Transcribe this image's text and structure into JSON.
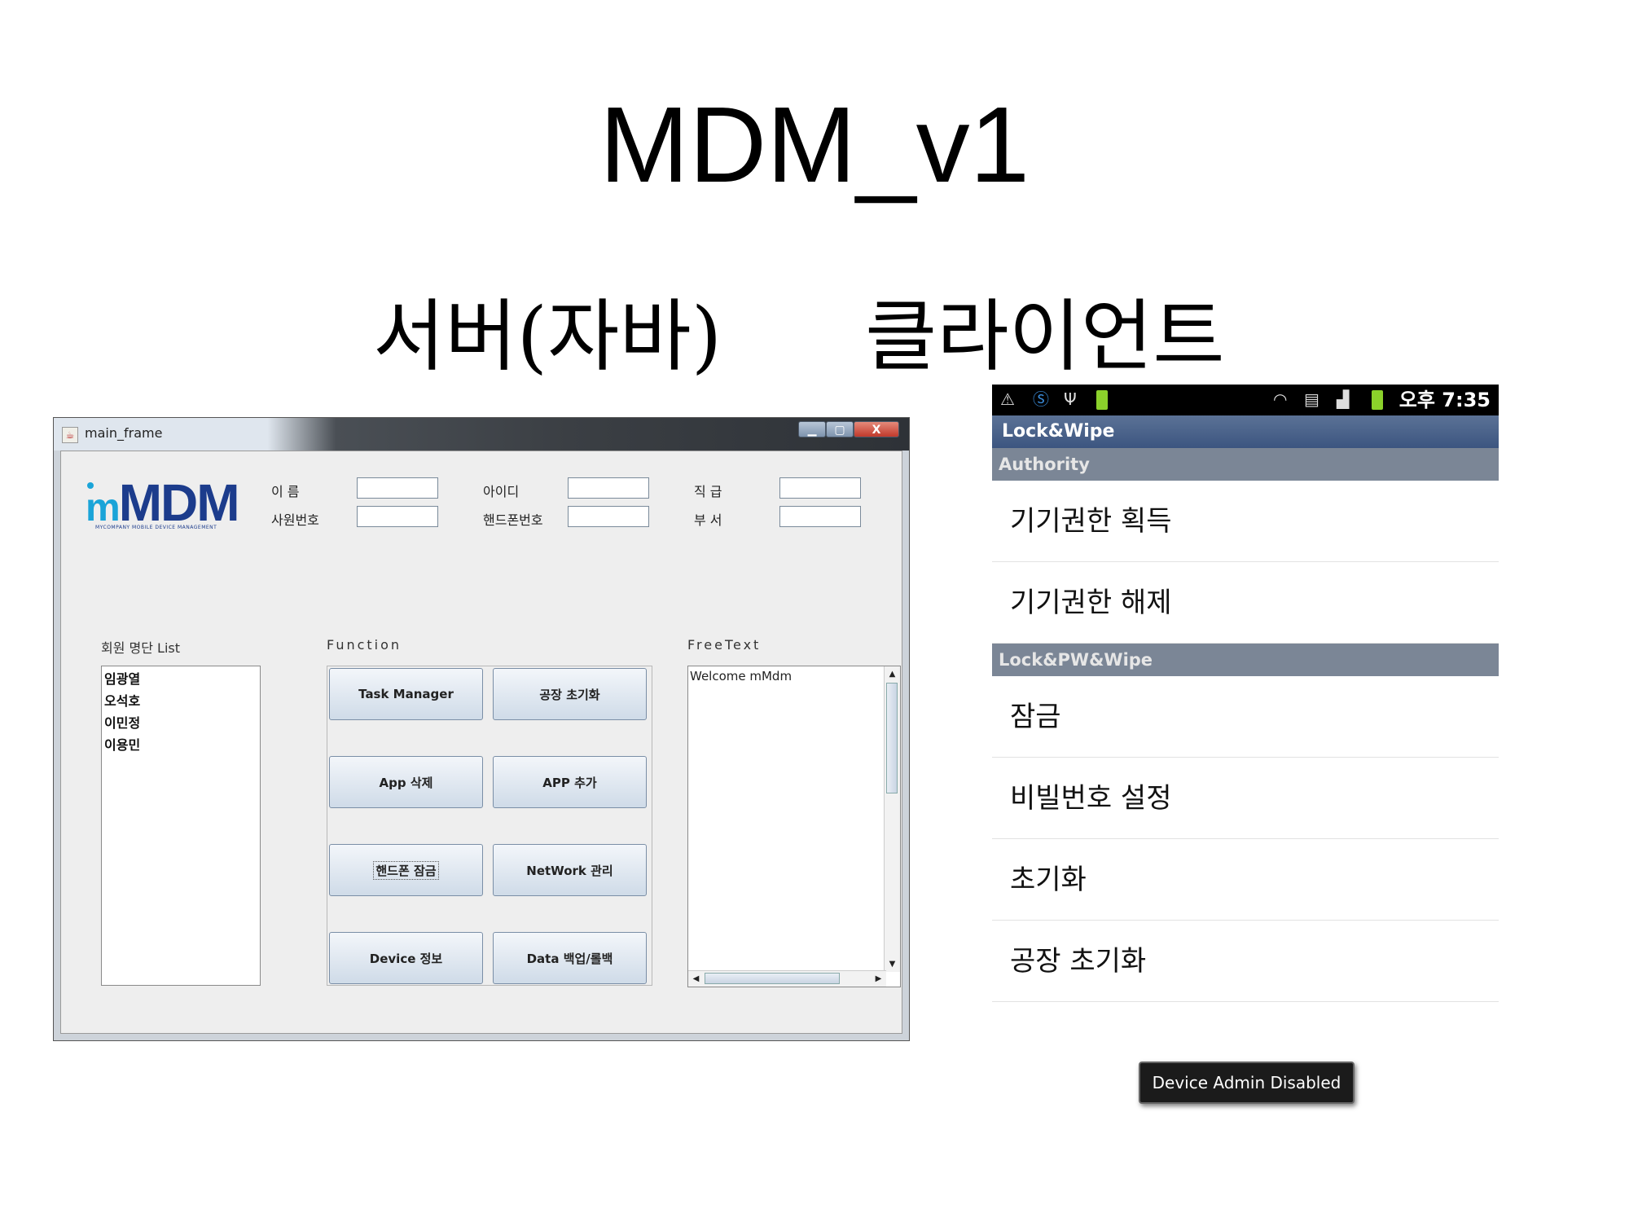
{
  "slide": {
    "title": "MDM_v1",
    "server_heading": "서버(자바)",
    "client_heading": "클라이언트"
  },
  "server_window": {
    "title": "main_frame",
    "controls": {
      "minimize": "▁",
      "maximize": "▢",
      "close": "X"
    },
    "logo": {
      "text_small": "m",
      "text_big": "MDM",
      "tagline": "MYCOMPANY MOBILE DEVICE MANAGEMENT"
    },
    "fields": [
      {
        "label": "이  름",
        "value": ""
      },
      {
        "label": "아이디",
        "value": ""
      },
      {
        "label": "직  급",
        "value": ""
      },
      {
        "label": "사원번호",
        "value": ""
      },
      {
        "label": "핸드폰번호",
        "value": ""
      },
      {
        "label": "부  서",
        "value": ""
      }
    ],
    "member_section": "회원 명단 List",
    "members": [
      "임광열",
      "오석호",
      "이민정",
      "이용민"
    ],
    "function_section": "Function",
    "functions": [
      "Task Manager",
      "공장 초기화",
      "App 삭제",
      "APP 추가",
      "핸드폰 잠금",
      "NetWork 관리",
      "Device 정보",
      "Data 백업/롤백"
    ],
    "freetext_section": "FreeText",
    "freetext": "Welcome mMdm",
    "scroll": {
      "up": "▲",
      "down": "▼",
      "left": "◀",
      "right": "▶",
      "grip_v": "≡",
      "grip_h": "|||"
    }
  },
  "client_app": {
    "status_bar": {
      "time": "오후 7:35",
      "battery_label": "100%",
      "icons": [
        "usb-debug-icon",
        "skype-icon",
        "usb-icon",
        "battery-icon",
        "wifi-icon",
        "sim-icon",
        "signal-icon",
        "battery-icon"
      ]
    },
    "app_title": "Lock&Wipe",
    "categories": [
      "Authority",
      "Lock&PW&Wipe"
    ],
    "authority_items": [
      "기기권한 획득",
      "기기권한 해제"
    ],
    "lock_items": [
      "잠금",
      "비빌번호 설정",
      "초기화",
      "공장 초기화"
    ],
    "toast": "Device Admin Disabled"
  }
}
